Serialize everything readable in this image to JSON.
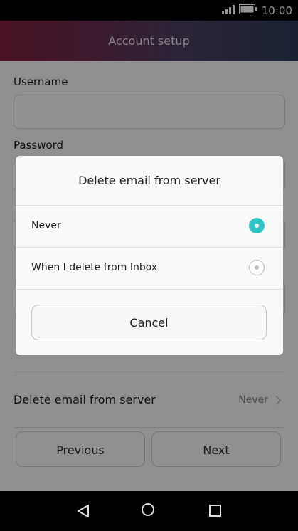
{
  "status_bar": {
    "time": "10:00",
    "icons": [
      "signal-icon",
      "battery-icon"
    ]
  },
  "header": {
    "title": "Account setup"
  },
  "form": {
    "username_label": "Username",
    "username_value": "",
    "password_label": "Password"
  },
  "setting": {
    "label": "Delete email from server",
    "value": "Never"
  },
  "bottom_buttons": {
    "previous": "Previous",
    "next": "Next"
  },
  "dialog": {
    "title": "Delete email from server",
    "options": [
      {
        "label": "Never",
        "selected": true
      },
      {
        "label": "When I delete from Inbox",
        "selected": false
      }
    ],
    "cancel": "Cancel"
  },
  "nav_bar": {
    "icons": [
      "back-icon",
      "home-icon",
      "recent-apps-icon"
    ]
  },
  "colors": {
    "accent": "#2ec4c6",
    "header_start": "#7a1f3d",
    "header_end": "#2c3a55"
  }
}
